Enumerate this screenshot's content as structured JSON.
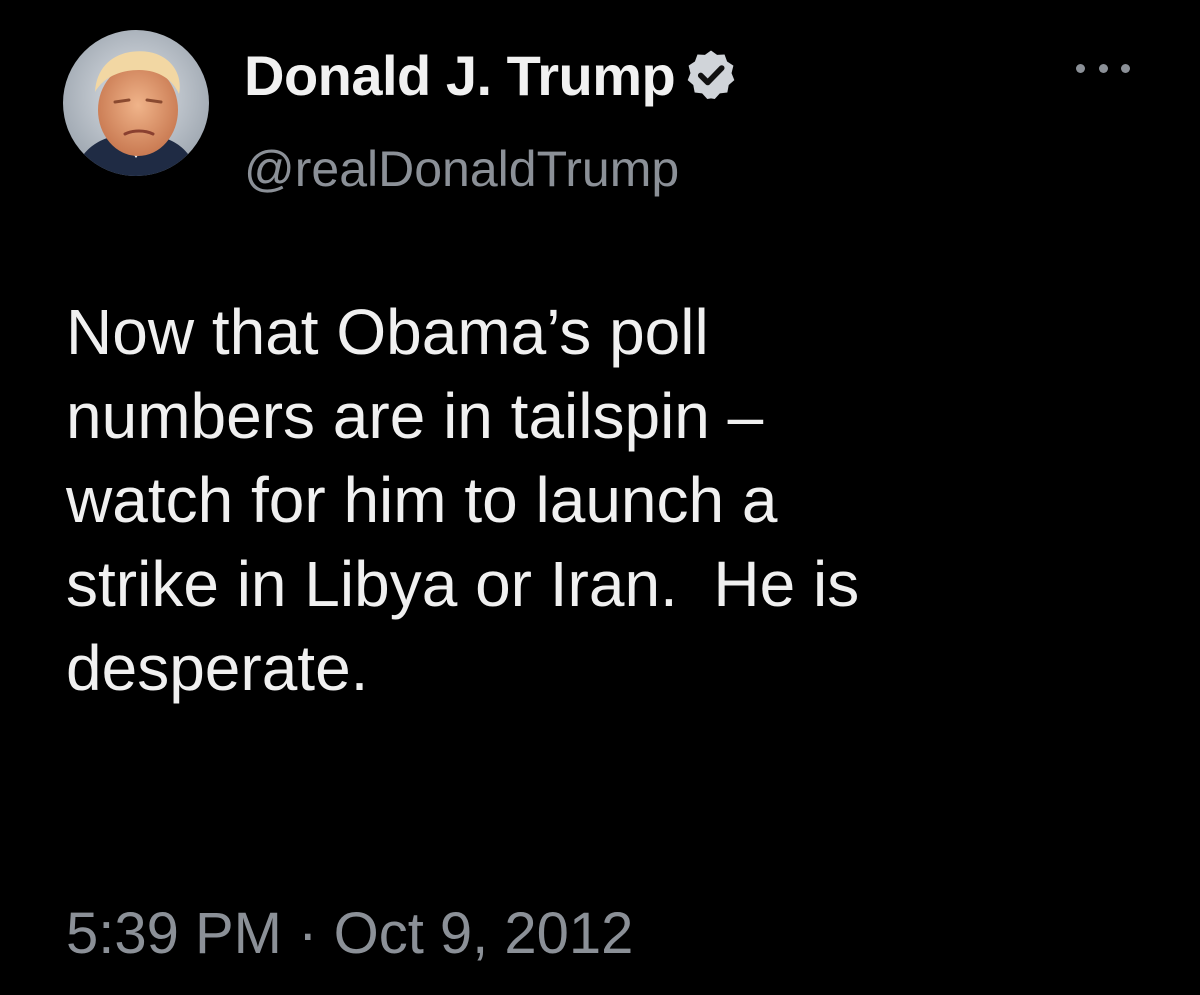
{
  "author": {
    "display_name": "Donald J. Trump",
    "handle": "@realDonaldTrump",
    "verified": true,
    "verified_badge_color": "#d0d4d9"
  },
  "tweet": {
    "lines": [
      "Now that Obama’s poll",
      "numbers are in tailspin –",
      "watch for him to launch a",
      "strike in Libya or Iran.  He is",
      "desperate."
    ],
    "time": "5:39 PM",
    "separator": "·",
    "date": "Oct 9, 2012"
  },
  "icons": {
    "more": "more-options-icon",
    "verified": "verified-badge-icon"
  },
  "colors": {
    "background": "#000000",
    "primary_text": "#f0f0f0",
    "secondary_text": "#8b9097"
  }
}
